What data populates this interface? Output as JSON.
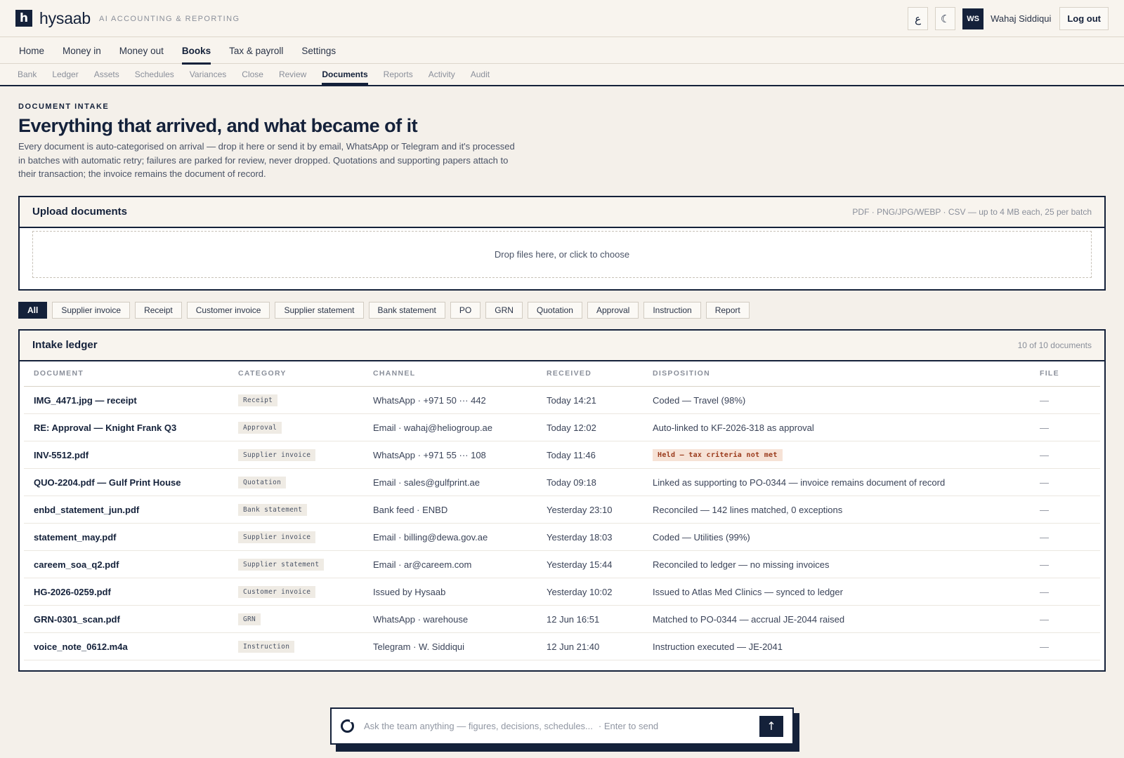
{
  "app": {
    "logo_letter": "h",
    "brand": "hysaab",
    "tagline": "AI ACCOUNTING & REPORTING",
    "lang_toggle": "ع",
    "theme_toggle": "☾",
    "user_initials": "WS",
    "user_name": "Wahaj Siddiqui",
    "logout_label": "Log out"
  },
  "main_nav": [
    "Home",
    "Money in",
    "Money out",
    "Books",
    "Tax & payroll",
    "Settings"
  ],
  "main_nav_active": "Books",
  "sub_nav": [
    "Bank",
    "Ledger",
    "Assets",
    "Schedules",
    "Variances",
    "Close",
    "Review",
    "Documents",
    "Reports",
    "Activity",
    "Audit"
  ],
  "sub_nav_active": "Documents",
  "header": {
    "eyebrow": "DOCUMENT INTAKE",
    "title": "Everything that arrived, and what became of it",
    "description": "Every document is auto-categorised on arrival — drop it here or send it by email, WhatsApp or Telegram and it's processed in batches with automatic retry; failures are parked for review, never dropped. Quotations and supporting papers attach to their transaction; the invoice remains the document of record."
  },
  "upload": {
    "title": "Upload documents",
    "limits": "PDF · PNG/JPG/WEBP · CSV — up to 4 MB each, 25 per batch",
    "dropzone": "Drop files here, or click to choose"
  },
  "filters": [
    "All",
    "Supplier invoice",
    "Receipt",
    "Customer invoice",
    "Supplier statement",
    "Bank statement",
    "PO",
    "GRN",
    "Quotation",
    "Approval",
    "Instruction",
    "Report"
  ],
  "filter_active": "All",
  "ledger": {
    "title": "Intake ledger",
    "count": "10 of 10 documents",
    "columns": [
      "DOCUMENT",
      "CATEGORY",
      "CHANNEL",
      "RECEIVED",
      "DISPOSITION",
      "FILE"
    ],
    "rows": [
      {
        "document": "IMG_4471.jpg — receipt",
        "category": "Receipt",
        "channel": "WhatsApp · +971 50 ··· 442",
        "received": "Today 14:21",
        "disposition": "Coded — Travel (98%)",
        "held": false,
        "file": "—"
      },
      {
        "document": "RE: Approval — Knight Frank Q3",
        "category": "Approval",
        "channel": "Email · wahaj@heliogroup.ae",
        "received": "Today 12:02",
        "disposition": "Auto-linked to KF-2026-318 as approval",
        "held": false,
        "file": "—"
      },
      {
        "document": "INV-5512.pdf",
        "category": "Supplier invoice",
        "channel": "WhatsApp · +971 55 ··· 108",
        "received": "Today 11:46",
        "disposition": "Held — tax criteria not met",
        "held": true,
        "file": "—"
      },
      {
        "document": "QUO-2204.pdf — Gulf Print House",
        "category": "Quotation",
        "channel": "Email · sales@gulfprint.ae",
        "received": "Today 09:18",
        "disposition": "Linked as supporting to PO-0344 — invoice remains document of record",
        "held": false,
        "file": "—"
      },
      {
        "document": "enbd_statement_jun.pdf",
        "category": "Bank statement",
        "channel": "Bank feed · ENBD",
        "received": "Yesterday 23:10",
        "disposition": "Reconciled — 142 lines matched, 0 exceptions",
        "held": false,
        "file": "—"
      },
      {
        "document": "statement_may.pdf",
        "category": "Supplier invoice",
        "channel": "Email · billing@dewa.gov.ae",
        "received": "Yesterday 18:03",
        "disposition": "Coded — Utilities (99%)",
        "held": false,
        "file": "—"
      },
      {
        "document": "careem_soa_q2.pdf",
        "category": "Supplier statement",
        "channel": "Email · ar@careem.com",
        "received": "Yesterday 15:44",
        "disposition": "Reconciled to ledger — no missing invoices",
        "held": false,
        "file": "—"
      },
      {
        "document": "HG-2026-0259.pdf",
        "category": "Customer invoice",
        "channel": "Issued by Hysaab",
        "received": "Yesterday 10:02",
        "disposition": "Issued to Atlas Med Clinics — synced to ledger",
        "held": false,
        "file": "—"
      },
      {
        "document": "GRN-0301_scan.pdf",
        "category": "GRN",
        "channel": "WhatsApp · warehouse",
        "received": "12 Jun 16:51",
        "disposition": "Matched to PO-0344 — accrual JE-2044 raised",
        "held": false,
        "file": "—"
      },
      {
        "document": "voice_note_0612.m4a",
        "category": "Instruction",
        "channel": "Telegram · W. Siddiqui",
        "received": "12 Jun 21:40",
        "disposition": "Instruction executed — JE-2041",
        "held": false,
        "file": "—"
      }
    ]
  },
  "chat": {
    "placeholder": "Ask the team anything — figures, decisions, schedules...",
    "hint": "· Enter to send",
    "send_icon": "↑"
  },
  "colors": {
    "ink": "#14213a",
    "page_bg": "#f4f0ea",
    "held_bg": "#f6e2d6",
    "held_text": "#9a3a1c"
  }
}
